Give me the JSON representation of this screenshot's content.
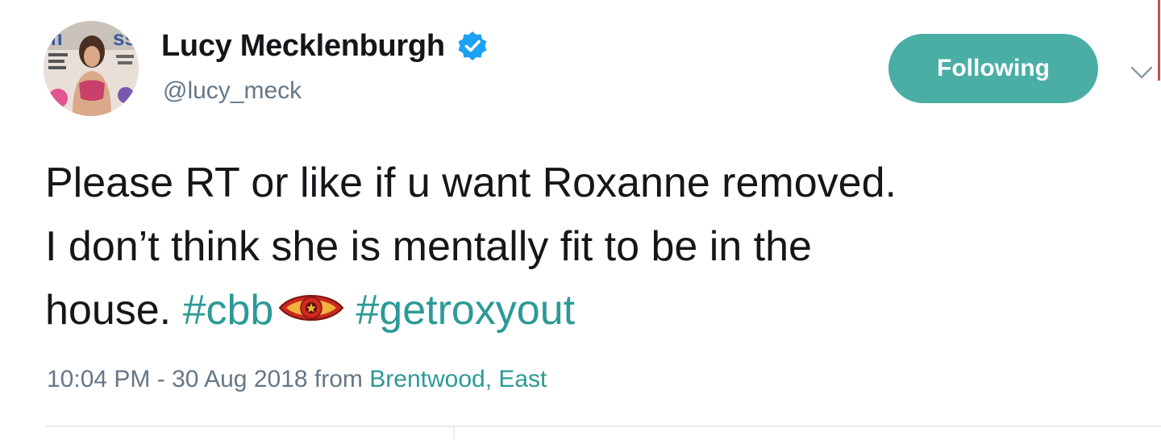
{
  "profile": {
    "display_name": "Lucy Mecklenburgh",
    "handle": "@lucy_meck",
    "verified": true,
    "avatar_icon": "magazine-cover-avatar"
  },
  "follow_button": {
    "label": "Following",
    "color": "#4aaea5"
  },
  "menu_icon": "chevron-down-icon",
  "tweet": {
    "line1": "Please RT or like if u want Roxanne removed.",
    "line2": "I don’t think she is mentally fit to be in the",
    "line3_prefix": "house.",
    "hashtags": [
      "#cbb",
      "#getroxyout"
    ],
    "emoji": "big-brother-eye-icon"
  },
  "meta": {
    "time": "10:04 PM - 30 Aug 2018",
    "from_label": "from",
    "location": "Brentwood, East"
  },
  "colors": {
    "link": "#2b9a96",
    "text": "#14171a",
    "secondary": "#657786",
    "verified": "#1da1f2"
  }
}
